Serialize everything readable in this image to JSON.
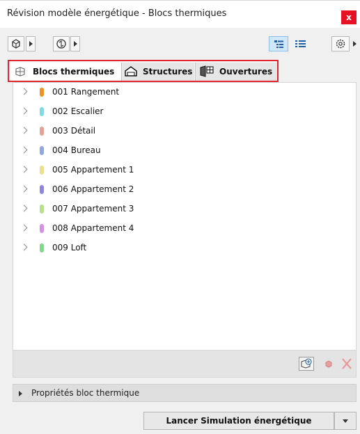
{
  "window": {
    "title": "Révision modèle énergétique - Blocs thermiques",
    "close_glyph": "x"
  },
  "toolbar": {
    "left_tools": [
      "cube-icon",
      "refresh-icon"
    ],
    "right_tools": [
      "tree-view-icon",
      "list-view-icon",
      "settings-icon"
    ]
  },
  "tabs": [
    {
      "label": "Blocs thermiques",
      "icon": "thermal-blocks-icon",
      "active": true
    },
    {
      "label": "Structures",
      "icon": "house-icon",
      "active": false
    },
    {
      "label": "Ouvertures",
      "icon": "openings-icon",
      "active": false
    }
  ],
  "list": {
    "items": [
      {
        "label": "001 Rangement",
        "color": "#f0921e"
      },
      {
        "label": "002 Escalier",
        "color": "#7fd9e6"
      },
      {
        "label": "003 Détail",
        "color": "#e7a296"
      },
      {
        "label": "004 Bureau",
        "color": "#8fa9e0"
      },
      {
        "label": "005 Appartement 1",
        "color": "#ece08a"
      },
      {
        "label": "006 Appartement 2",
        "color": "#8e86da"
      },
      {
        "label": "007 Appartement 3",
        "color": "#b7e08a"
      },
      {
        "label": "008 Appartement 4",
        "color": "#d88fe6"
      },
      {
        "label": "009 Loft",
        "color": "#7ed98a"
      }
    ]
  },
  "properties": {
    "label": "Propriétés bloc thermique"
  },
  "footer": {
    "simulate_label": "Lancer Simulation énergétique"
  },
  "colors": {
    "highlight": "#e0242b",
    "close": "#e81123"
  }
}
